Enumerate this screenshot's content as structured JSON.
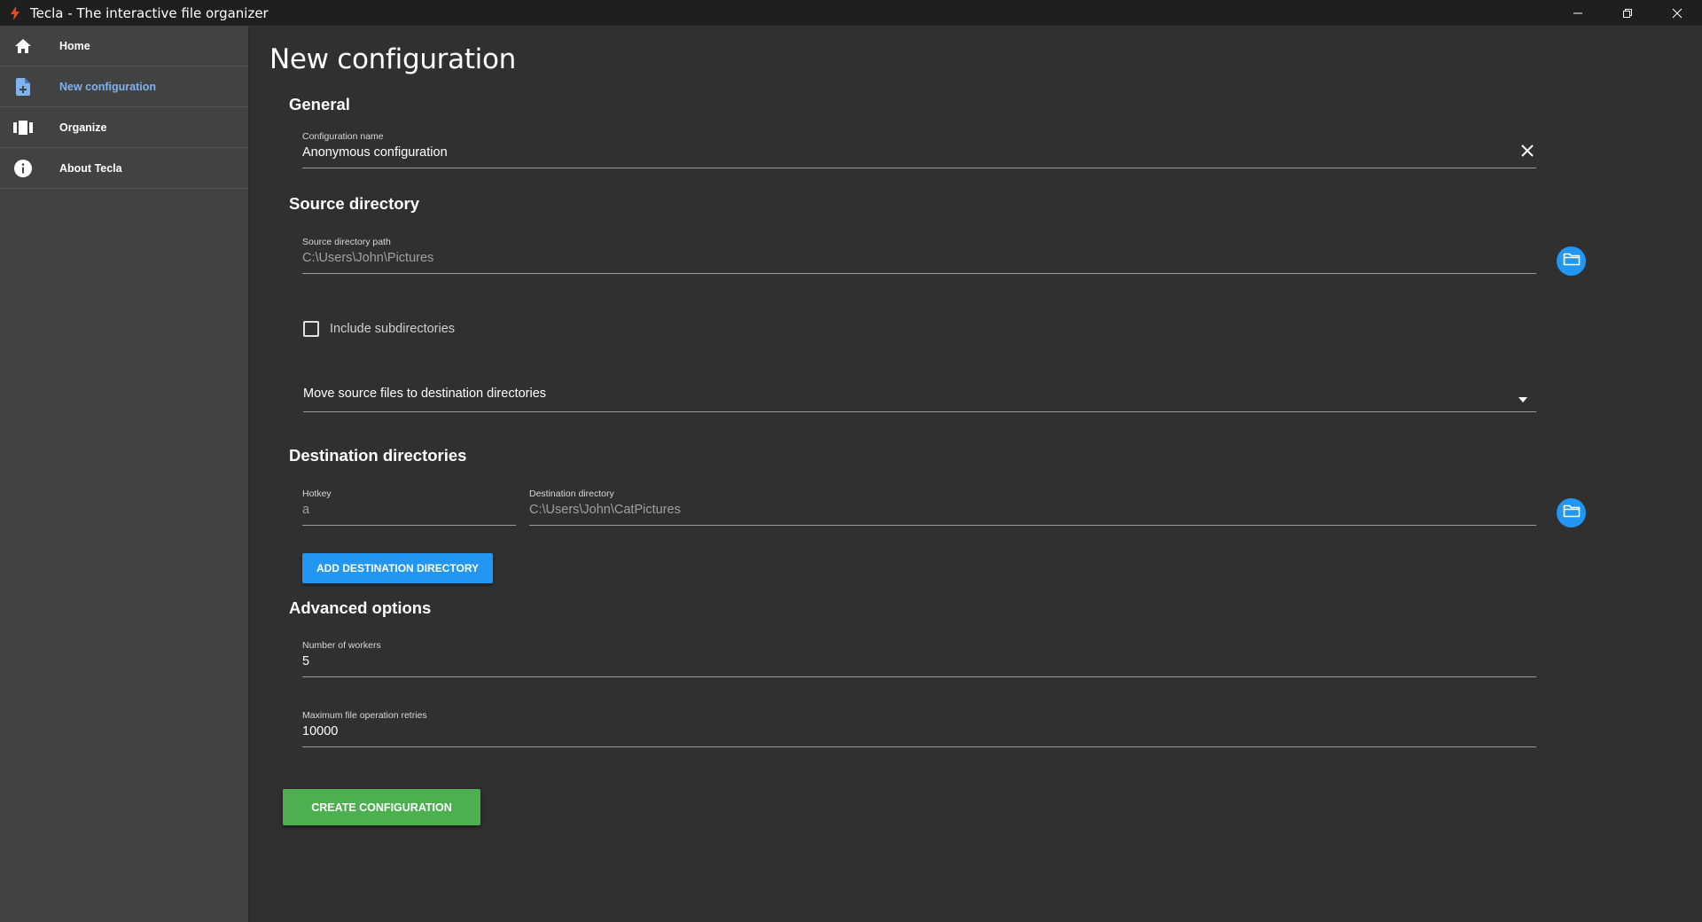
{
  "window": {
    "title": "Tecla - The interactive file organizer",
    "app_icon": "lightning-bolt-icon"
  },
  "sidebar": {
    "items": [
      {
        "label": "Home",
        "icon": "home-icon",
        "active": false
      },
      {
        "label": "New configuration",
        "icon": "new-file-icon",
        "active": true
      },
      {
        "label": "Organize",
        "icon": "view-carousel-icon",
        "active": false
      },
      {
        "label": "About Tecla",
        "icon": "info-icon",
        "active": false
      }
    ]
  },
  "main": {
    "page_title": "New configuration",
    "general": {
      "section_title": "General",
      "config_name_label": "Configuration name",
      "config_name_value": "Anonymous configuration"
    },
    "source": {
      "section_title": "Source directory",
      "path_label": "Source directory path",
      "path_placeholder": "C:\\Users\\John\\Pictures",
      "include_subdirs_label": "Include subdirectories",
      "include_subdirs_checked": false,
      "operation_value": "Move source files to destination directories"
    },
    "destination": {
      "section_title": "Destination directories",
      "hotkey_label": "Hotkey",
      "hotkey_placeholder": "a",
      "dir_label": "Destination directory",
      "dir_placeholder": "C:\\Users\\John\\CatPictures",
      "add_button": "ADD DESTINATION DIRECTORY"
    },
    "advanced": {
      "section_title": "Advanced options",
      "workers_label": "Number of workers",
      "workers_value": "5",
      "retries_label": "Maximum file operation retries",
      "retries_value": "10000"
    },
    "create_button": "CREATE CONFIGURATION"
  },
  "colors": {
    "accent_blue": "#2196f3",
    "success_green": "#4caf50",
    "active_nav": "#7fb3f0",
    "background": "#303030",
    "sidebar": "#424242"
  }
}
